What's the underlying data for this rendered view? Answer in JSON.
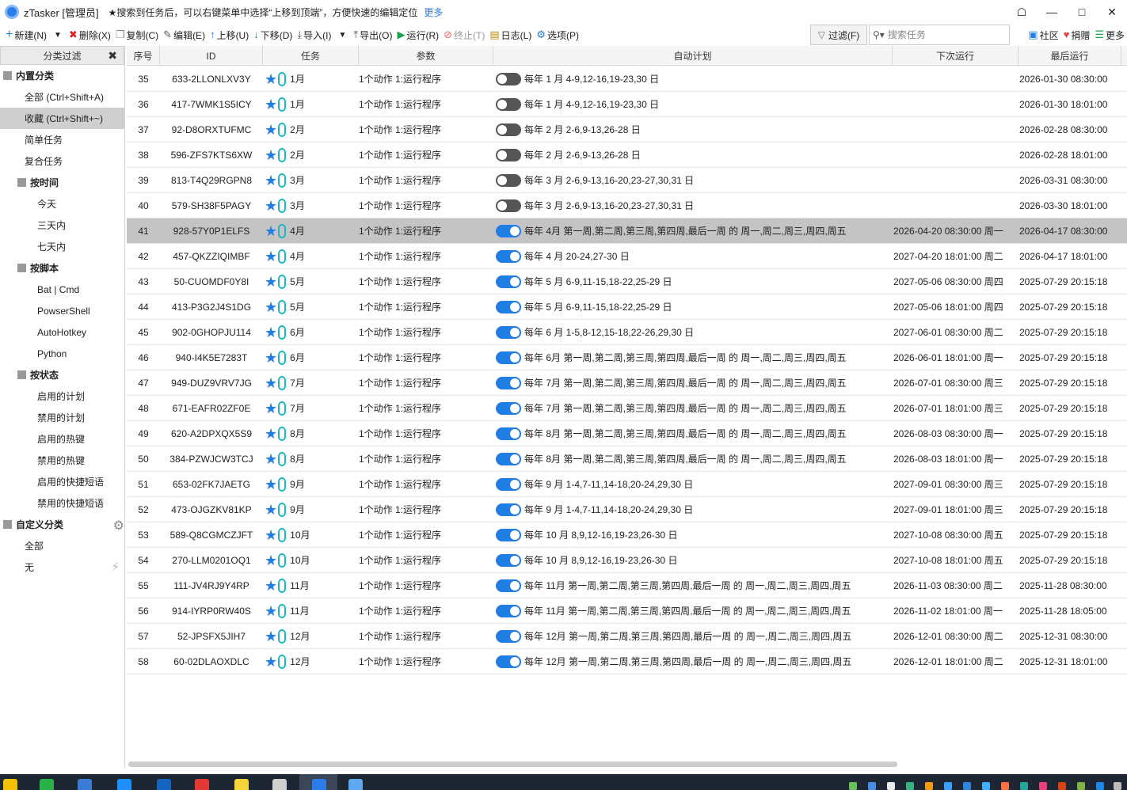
{
  "titlebar": {
    "app_title": "zTasker [管理员]",
    "tip": "★搜索到任务后，可以右键菜单中选择“上移到顶端”，方便快速的编辑定位",
    "more_link": "更多"
  },
  "toolbar": {
    "new_label": "新建(N)",
    "delete_label": "删除(X)",
    "copy_label": "复制(C)",
    "edit_label": "编辑(E)",
    "up_label": "上移(U)",
    "down_label": "下移(D)",
    "import_label": "导入(I)",
    "export_label": "导出(O)",
    "run_label": "运行(R)",
    "stop_label": "终止(T)",
    "log_label": "日志(L)",
    "options_label": "选项(P)",
    "filter_label": "过滤(F)",
    "search_placeholder": "搜索任务",
    "community_label": "社区",
    "donate_label": "捐赠",
    "more_label": "更多"
  },
  "sidebar": {
    "header": "分类过滤",
    "builtin": "内置分类",
    "all": "全部 (Ctrl+Shift+A)",
    "favorites": "收藏 (Ctrl+Shift+~)",
    "simple": "简单任务",
    "compound": "复合任务",
    "by_time": "按时间",
    "today": "今天",
    "three_days": "三天内",
    "seven_days": "七天内",
    "by_script": "按脚本",
    "bat": "Bat | Cmd",
    "powershell": "PowserShell",
    "autohotkey": "AutoHotkey",
    "python": "Python",
    "by_status": "按状态",
    "enabled_plans": "启用的计划",
    "disabled_plans": "禁用的计划",
    "enabled_hotkeys": "启用的热键",
    "disabled_hotkeys": "禁用的热键",
    "enabled_phrases": "启用的快捷短语",
    "disabled_phrases": "禁用的快捷短语",
    "custom": "自定义分类",
    "custom_all": "全部",
    "custom_none": "无"
  },
  "columns": {
    "seq": "序号",
    "id": "ID",
    "task": "任务",
    "param": "参数",
    "schedule": "自动计划",
    "next_run": "下次运行",
    "last_run": "最后运行"
  },
  "accent_color": "#1f7de6",
  "rows": [
    {
      "seq": "35",
      "id": "633-2LLONLXV3Y",
      "task": "1月",
      "param": "1个动作 1:运行程序",
      "enabled": false,
      "schedule": "每年 1 月 4-9,12-16,19-23,30 日",
      "next": "",
      "last": "2026-01-30 08:30:00"
    },
    {
      "seq": "36",
      "id": "417-7WMK1S5ICY",
      "task": "1月",
      "param": "1个动作 1:运行程序",
      "enabled": false,
      "schedule": "每年 1 月 4-9,12-16,19-23,30 日",
      "next": "",
      "last": "2026-01-30 18:01:00"
    },
    {
      "seq": "37",
      "id": "92-D8ORXTUFMC",
      "task": "2月",
      "param": "1个动作 1:运行程序",
      "enabled": false,
      "schedule": "每年 2 月 2-6,9-13,26-28 日",
      "next": "",
      "last": "2026-02-28 08:30:00"
    },
    {
      "seq": "38",
      "id": "596-ZFS7KTS6XW",
      "task": "2月",
      "param": "1个动作 1:运行程序",
      "enabled": false,
      "schedule": "每年 2 月 2-6,9-13,26-28 日",
      "next": "",
      "last": "2026-02-28 18:01:00"
    },
    {
      "seq": "39",
      "id": "813-T4Q29RGPN8",
      "task": "3月",
      "param": "1个动作 1:运行程序",
      "enabled": false,
      "schedule": "每年 3 月 2-6,9-13,16-20,23-27,30,31 日",
      "next": "",
      "last": "2026-03-31 08:30:00"
    },
    {
      "seq": "40",
      "id": "579-SH38F5PAGY",
      "task": "3月",
      "param": "1个动作 1:运行程序",
      "enabled": false,
      "schedule": "每年 3 月 2-6,9-13,16-20,23-27,30,31 日",
      "next": "",
      "last": "2026-03-30 18:01:00"
    },
    {
      "seq": "41",
      "id": "928-57Y0P1ELFS",
      "task": "4月",
      "param": "1个动作 1:运行程序",
      "enabled": true,
      "schedule": "每年 4月 第一周,第二周,第三周,第四周,最后一周 的 周一,周二,周三,周四,周五",
      "next": "2026-04-20 08:30:00 周一",
      "last": "2026-04-17 08:30:00",
      "selected": true
    },
    {
      "seq": "42",
      "id": "457-QKZZIQIMBF",
      "task": "4月",
      "param": "1个动作 1:运行程序",
      "enabled": true,
      "schedule": "每年 4 月 20-24,27-30 日",
      "next": "2027-04-20 18:01:00 周二",
      "last": "2026-04-17 18:01:00"
    },
    {
      "seq": "43",
      "id": "50-CUOMDF0Y8I",
      "task": "5月",
      "param": "1个动作 1:运行程序",
      "enabled": true,
      "schedule": "每年 5 月 6-9,11-15,18-22,25-29 日",
      "next": "2027-05-06 08:30:00 周四",
      "last": "2025-07-29 20:15:18"
    },
    {
      "seq": "44",
      "id": "413-P3G2J4S1DG",
      "task": "5月",
      "param": "1个动作 1:运行程序",
      "enabled": true,
      "schedule": "每年 5 月 6-9,11-15,18-22,25-29 日",
      "next": "2027-05-06 18:01:00 周四",
      "last": "2025-07-29 20:15:18"
    },
    {
      "seq": "45",
      "id": "902-0GHOPJU114",
      "task": "6月",
      "param": "1个动作 1:运行程序",
      "enabled": true,
      "schedule": "每年 6 月 1-5,8-12,15-18,22-26,29,30 日",
      "next": "2027-06-01 08:30:00 周二",
      "last": "2025-07-29 20:15:18"
    },
    {
      "seq": "46",
      "id": "940-I4K5E7283T",
      "task": "6月",
      "param": "1个动作 1:运行程序",
      "enabled": true,
      "schedule": "每年 6月 第一周,第二周,第三周,第四周,最后一周 的 周一,周二,周三,周四,周五",
      "next": "2026-06-01 18:01:00 周一",
      "last": "2025-07-29 20:15:18"
    },
    {
      "seq": "47",
      "id": "949-DUZ9VRV7JG",
      "task": "7月",
      "param": "1个动作 1:运行程序",
      "enabled": true,
      "schedule": "每年 7月 第一周,第二周,第三周,第四周,最后一周 的 周一,周二,周三,周四,周五",
      "next": "2026-07-01 08:30:00 周三",
      "last": "2025-07-29 20:15:18"
    },
    {
      "seq": "48",
      "id": "671-EAFR02ZF0E",
      "task": "7月",
      "param": "1个动作 1:运行程序",
      "enabled": true,
      "schedule": "每年 7月 第一周,第二周,第三周,第四周,最后一周 的 周一,周二,周三,周四,周五",
      "next": "2026-07-01 18:01:00 周三",
      "last": "2025-07-29 20:15:18"
    },
    {
      "seq": "49",
      "id": "620-A2DPXQX5S9",
      "task": "8月",
      "param": "1个动作 1:运行程序",
      "enabled": true,
      "schedule": "每年 8月 第一周,第二周,第三周,第四周,最后一周 的 周一,周二,周三,周四,周五",
      "next": "2026-08-03 08:30:00 周一",
      "last": "2025-07-29 20:15:18"
    },
    {
      "seq": "50",
      "id": "384-PZWJCW3TCJ",
      "task": "8月",
      "param": "1个动作 1:运行程序",
      "enabled": true,
      "schedule": "每年 8月 第一周,第二周,第三周,第四周,最后一周 的 周一,周二,周三,周四,周五",
      "next": "2026-08-03 18:01:00 周一",
      "last": "2025-07-29 20:15:18"
    },
    {
      "seq": "51",
      "id": "653-02FK7JAETG",
      "task": "9月",
      "param": "1个动作 1:运行程序",
      "enabled": true,
      "schedule": "每年 9 月 1-4,7-11,14-18,20-24,29,30 日",
      "next": "2027-09-01 08:30:00 周三",
      "last": "2025-07-29 20:15:18"
    },
    {
      "seq": "52",
      "id": "473-OJGZKV81KP",
      "task": "9月",
      "param": "1个动作 1:运行程序",
      "enabled": true,
      "schedule": "每年 9 月 1-4,7-11,14-18,20-24,29,30 日",
      "next": "2027-09-01 18:01:00 周三",
      "last": "2025-07-29 20:15:18"
    },
    {
      "seq": "53",
      "id": "589-Q8CGMCZJFT",
      "task": "10月",
      "param": "1个动作 1:运行程序",
      "enabled": true,
      "schedule": "每年 10 月 8,9,12-16,19-23,26-30 日",
      "next": "2027-10-08 08:30:00 周五",
      "last": "2025-07-29 20:15:18"
    },
    {
      "seq": "54",
      "id": "270-LLM0201OQ1",
      "task": "10月",
      "param": "1个动作 1:运行程序",
      "enabled": true,
      "schedule": "每年 10 月 8,9,12-16,19-23,26-30 日",
      "next": "2027-10-08 18:01:00 周五",
      "last": "2025-07-29 20:15:18"
    },
    {
      "seq": "55",
      "id": "111-JV4RJ9Y4RP",
      "task": "11月",
      "param": "1个动作 1:运行程序",
      "enabled": true,
      "schedule": "每年 11月 第一周,第二周,第三周,第四周,最后一周 的 周一,周二,周三,周四,周五",
      "next": "2026-11-03 08:30:00 周二",
      "last": "2025-11-28 08:30:00"
    },
    {
      "seq": "56",
      "id": "914-IYRP0RW40S",
      "task": "11月",
      "param": "1个动作 1:运行程序",
      "enabled": true,
      "schedule": "每年 11月 第一周,第二周,第三周,第四周,最后一周 的 周一,周二,周三,周四,周五",
      "next": "2026-11-02 18:01:00 周一",
      "last": "2025-11-28 18:05:00"
    },
    {
      "seq": "57",
      "id": "52-JPSFX5JIH7",
      "task": "12月",
      "param": "1个动作 1:运行程序",
      "enabled": true,
      "schedule": "每年 12月 第一周,第二周,第三周,第四周,最后一周 的 周一,周二,周三,周四,周五",
      "next": "2026-12-01 08:30:00 周二",
      "last": "2025-12-31 08:30:00"
    },
    {
      "seq": "58",
      "id": "60-02DLAOXDLC",
      "task": "12月",
      "param": "1个动作 1:运行程序",
      "enabled": true,
      "schedule": "每年 12月 第一周,第二周,第三周,第四周,最后一周 的 周一,周二,周三,周四,周五",
      "next": "2026-12-01 18:01:00 周二",
      "last": "2025-12-31 18:01:00"
    }
  ]
}
